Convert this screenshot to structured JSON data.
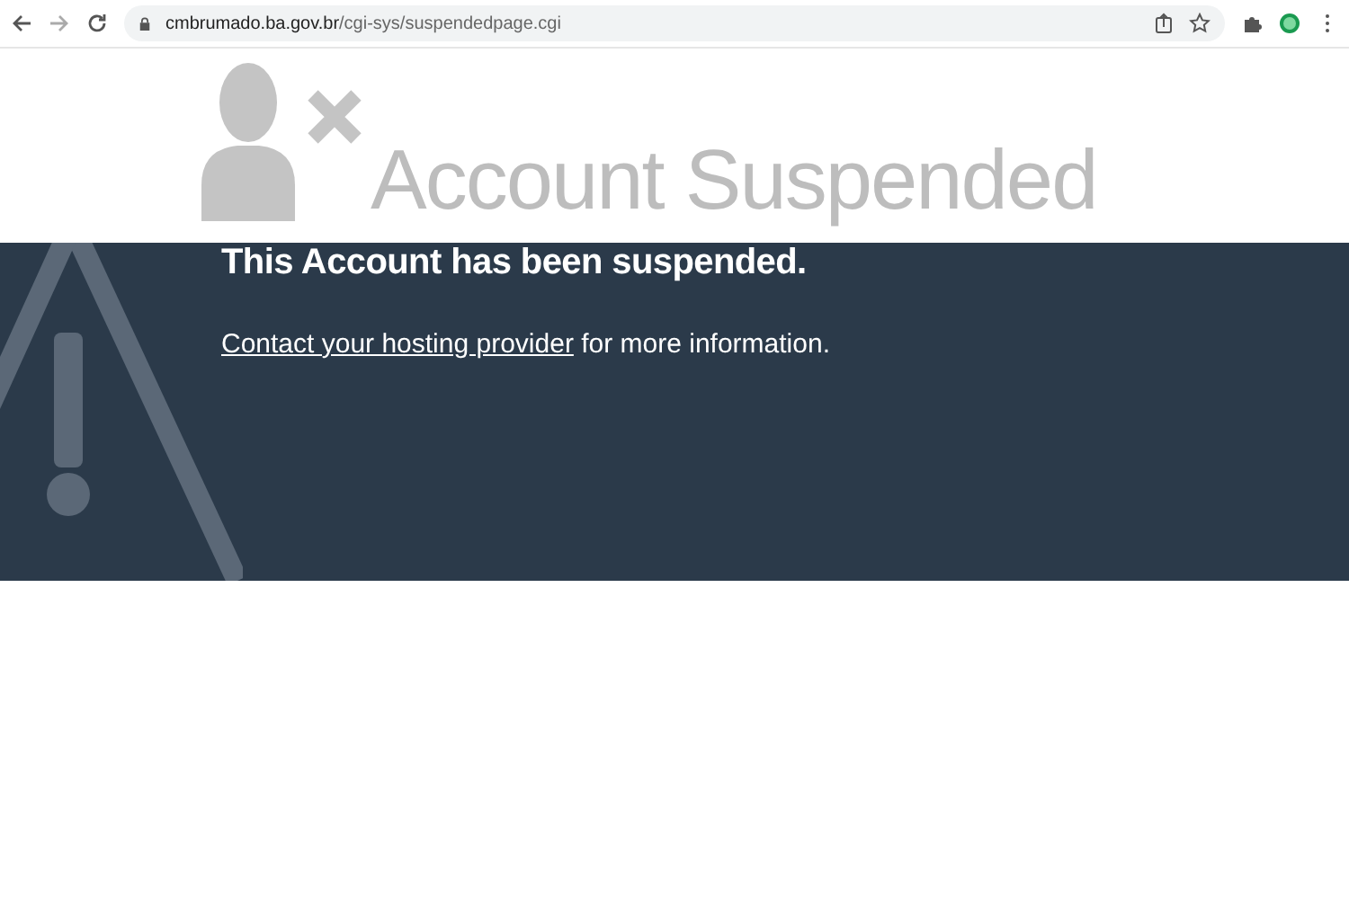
{
  "browser": {
    "url_host": "cmbrumado.ba.gov.br",
    "url_path": "/cgi-sys/suspendedpage.cgi"
  },
  "header": {
    "title": "Account Suspended"
  },
  "notice": {
    "heading": "This Account has been suspended.",
    "link": "Contact your hosting provider",
    "text": " for more information."
  }
}
